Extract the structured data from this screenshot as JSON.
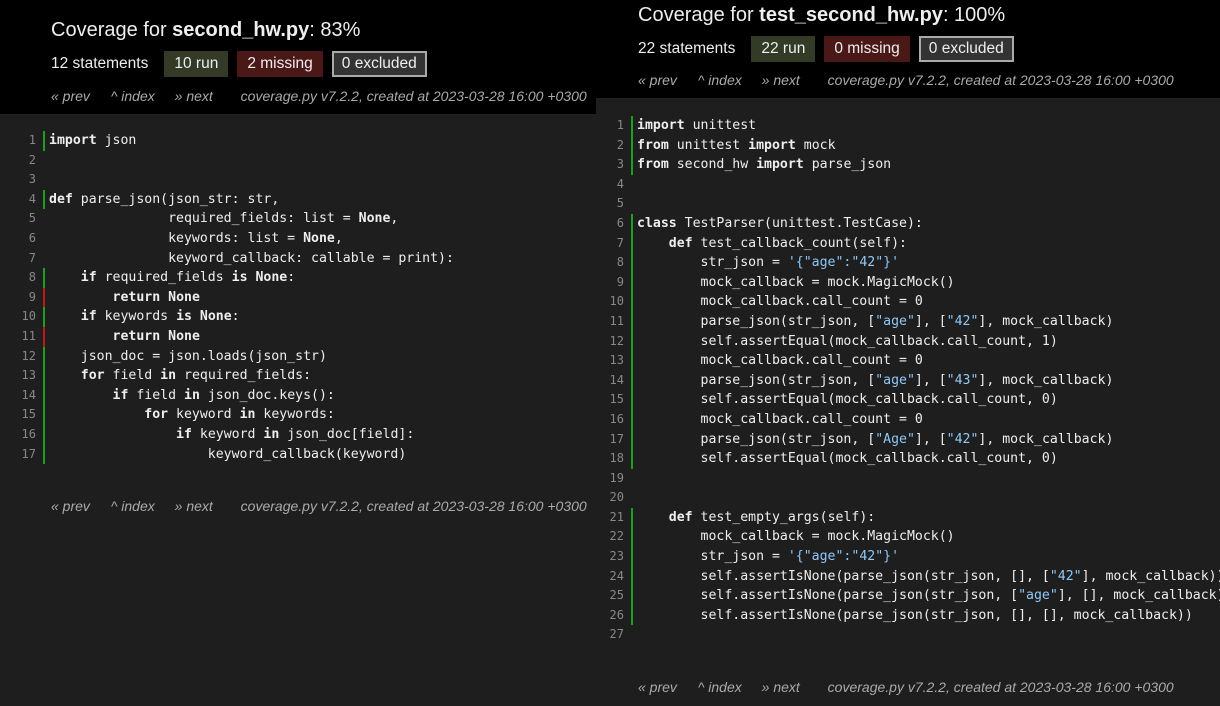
{
  "left": {
    "title_prefix": "Coverage for ",
    "file": "second_hw.py",
    "title_suffix": ": 83%",
    "statements": "12 statements",
    "run": "10 run",
    "missing": "2 missing",
    "excluded": "0 excluded",
    "nav": {
      "prev": "« prev",
      "index": "^ index",
      "next": "» next",
      "created": "coverage.py v7.2.2, created at 2023-03-28 16:00 +0300"
    },
    "lines": [
      {
        "n": "1",
        "s": "run",
        "t": [
          [
            "kw",
            "import"
          ],
          [
            "",
            " json"
          ]
        ]
      },
      {
        "n": "2",
        "s": "",
        "t": []
      },
      {
        "n": "3",
        "s": "",
        "t": []
      },
      {
        "n": "4",
        "s": "run",
        "t": [
          [
            "kw",
            "def"
          ],
          [
            "",
            " parse_json(json_str: str,"
          ]
        ]
      },
      {
        "n": "5",
        "s": "",
        "t": [
          [
            "",
            "               required_fields: list = "
          ],
          [
            "kw",
            "None"
          ],
          [
            "",
            ","
          ]
        ]
      },
      {
        "n": "6",
        "s": "",
        "t": [
          [
            "",
            "               keywords: list = "
          ],
          [
            "kw",
            "None"
          ],
          [
            "",
            ","
          ]
        ]
      },
      {
        "n": "7",
        "s": "",
        "t": [
          [
            "",
            "               keyword_callback: callable = print):"
          ]
        ]
      },
      {
        "n": "8",
        "s": "run",
        "t": [
          [
            "",
            "    "
          ],
          [
            "kw",
            "if"
          ],
          [
            "",
            " required_fields "
          ],
          [
            "kw",
            "is"
          ],
          [
            "",
            " "
          ],
          [
            "kw",
            "None"
          ],
          [
            "",
            ":"
          ]
        ]
      },
      {
        "n": "9",
        "s": "mis",
        "t": [
          [
            "",
            "        "
          ],
          [
            "kw",
            "return"
          ],
          [
            "",
            " "
          ],
          [
            "kw",
            "None"
          ]
        ]
      },
      {
        "n": "10",
        "s": "run",
        "t": [
          [
            "",
            "    "
          ],
          [
            "kw",
            "if"
          ],
          [
            "",
            " keywords "
          ],
          [
            "kw",
            "is"
          ],
          [
            "",
            " "
          ],
          [
            "kw",
            "None"
          ],
          [
            "",
            ":"
          ]
        ]
      },
      {
        "n": "11",
        "s": "mis",
        "t": [
          [
            "",
            "        "
          ],
          [
            "kw",
            "return"
          ],
          [
            "",
            " "
          ],
          [
            "kw",
            "None"
          ]
        ]
      },
      {
        "n": "12",
        "s": "run",
        "t": [
          [
            "",
            "    json_doc = json.loads(json_str)"
          ]
        ]
      },
      {
        "n": "13",
        "s": "run",
        "t": [
          [
            "",
            "    "
          ],
          [
            "kw",
            "for"
          ],
          [
            "",
            " field "
          ],
          [
            "kw",
            "in"
          ],
          [
            "",
            " required_fields:"
          ]
        ]
      },
      {
        "n": "14",
        "s": "run",
        "t": [
          [
            "",
            "        "
          ],
          [
            "kw",
            "if"
          ],
          [
            "",
            " field "
          ],
          [
            "kw",
            "in"
          ],
          [
            "",
            " json_doc.keys():"
          ]
        ]
      },
      {
        "n": "15",
        "s": "run",
        "t": [
          [
            "",
            "            "
          ],
          [
            "kw",
            "for"
          ],
          [
            "",
            " keyword "
          ],
          [
            "kw",
            "in"
          ],
          [
            "",
            " keywords:"
          ]
        ]
      },
      {
        "n": "16",
        "s": "run",
        "t": [
          [
            "",
            "                "
          ],
          [
            "kw",
            "if"
          ],
          [
            "",
            " keyword "
          ],
          [
            "kw",
            "in"
          ],
          [
            "",
            " json_doc[field]:"
          ]
        ]
      },
      {
        "n": "17",
        "s": "run",
        "t": [
          [
            "",
            "                    keyword_callback(keyword)"
          ]
        ]
      }
    ]
  },
  "right": {
    "title_prefix": "Coverage for ",
    "file": "test_second_hw.py",
    "title_suffix": ": 100%",
    "statements": "22 statements",
    "run": "22 run",
    "missing": "0 missing",
    "excluded": "0 excluded",
    "nav": {
      "prev": "« prev",
      "index": "^ index",
      "next": "» next",
      "created": "coverage.py v7.2.2, created at 2023-03-28 16:00 +0300"
    },
    "lines": [
      {
        "n": "1",
        "s": "run",
        "t": [
          [
            "kw",
            "import"
          ],
          [
            "",
            " unittest"
          ]
        ]
      },
      {
        "n": "2",
        "s": "run",
        "t": [
          [
            "kw",
            "from"
          ],
          [
            "",
            " unittest "
          ],
          [
            "kw",
            "import"
          ],
          [
            "",
            " mock"
          ]
        ]
      },
      {
        "n": "3",
        "s": "run",
        "t": [
          [
            "kw",
            "from"
          ],
          [
            "",
            " second_hw "
          ],
          [
            "kw",
            "import"
          ],
          [
            "",
            " parse_json"
          ]
        ]
      },
      {
        "n": "4",
        "s": "",
        "t": []
      },
      {
        "n": "5",
        "s": "",
        "t": []
      },
      {
        "n": "6",
        "s": "run",
        "t": [
          [
            "kw",
            "class"
          ],
          [
            "",
            " TestParser(unittest.TestCase):"
          ]
        ]
      },
      {
        "n": "7",
        "s": "run",
        "t": [
          [
            "",
            "    "
          ],
          [
            "kw",
            "def"
          ],
          [
            "",
            " test_callback_count(self):"
          ]
        ]
      },
      {
        "n": "8",
        "s": "run",
        "t": [
          [
            "",
            "        str_json = "
          ],
          [
            "str",
            "'{\"age\":\"42\"}'"
          ]
        ]
      },
      {
        "n": "9",
        "s": "run",
        "t": [
          [
            "",
            "        mock_callback = mock.MagicMock()"
          ]
        ]
      },
      {
        "n": "10",
        "s": "run",
        "t": [
          [
            "",
            "        mock_callback.call_count = 0"
          ]
        ]
      },
      {
        "n": "11",
        "s": "run",
        "t": [
          [
            "",
            "        parse_json(str_json, ["
          ],
          [
            "str",
            "\"age\""
          ],
          [
            "",
            "], ["
          ],
          [
            "str",
            "\"42\""
          ],
          [
            "",
            "], mock_callback)"
          ]
        ]
      },
      {
        "n": "12",
        "s": "run",
        "t": [
          [
            "",
            "        self.assertEqual(mock_callback.call_count, 1)"
          ]
        ]
      },
      {
        "n": "13",
        "s": "run",
        "t": [
          [
            "",
            "        mock_callback.call_count = 0"
          ]
        ]
      },
      {
        "n": "14",
        "s": "run",
        "t": [
          [
            "",
            "        parse_json(str_json, ["
          ],
          [
            "str",
            "\"age\""
          ],
          [
            "",
            "], ["
          ],
          [
            "str",
            "\"43\""
          ],
          [
            "",
            "], mock_callback)"
          ]
        ]
      },
      {
        "n": "15",
        "s": "run",
        "t": [
          [
            "",
            "        self.assertEqual(mock_callback.call_count, 0)"
          ]
        ]
      },
      {
        "n": "16",
        "s": "run",
        "t": [
          [
            "",
            "        mock_callback.call_count = 0"
          ]
        ]
      },
      {
        "n": "17",
        "s": "run",
        "t": [
          [
            "",
            "        parse_json(str_json, ["
          ],
          [
            "str",
            "\"Age\""
          ],
          [
            "",
            "], ["
          ],
          [
            "str",
            "\"42\""
          ],
          [
            "",
            "], mock_callback)"
          ]
        ]
      },
      {
        "n": "18",
        "s": "run",
        "t": [
          [
            "",
            "        self.assertEqual(mock_callback.call_count, 0)"
          ]
        ]
      },
      {
        "n": "19",
        "s": "",
        "t": []
      },
      {
        "n": "20",
        "s": "",
        "t": []
      },
      {
        "n": "21",
        "s": "run",
        "t": [
          [
            "",
            "    "
          ],
          [
            "kw",
            "def"
          ],
          [
            "",
            " test_empty_args(self):"
          ]
        ]
      },
      {
        "n": "22",
        "s": "run",
        "t": [
          [
            "",
            "        mock_callback = mock.MagicMock()"
          ]
        ]
      },
      {
        "n": "23",
        "s": "run",
        "t": [
          [
            "",
            "        str_json = "
          ],
          [
            "str",
            "'{\"age\":\"42\"}'"
          ]
        ]
      },
      {
        "n": "24",
        "s": "run",
        "t": [
          [
            "",
            "        self.assertIsNone(parse_json(str_json, [], ["
          ],
          [
            "str",
            "\"42\""
          ],
          [
            "",
            "], mock_callback))"
          ]
        ]
      },
      {
        "n": "25",
        "s": "run",
        "t": [
          [
            "",
            "        self.assertIsNone(parse_json(str_json, ["
          ],
          [
            "str",
            "\"age\""
          ],
          [
            "",
            "], [], mock_callback))"
          ]
        ]
      },
      {
        "n": "26",
        "s": "run",
        "t": [
          [
            "",
            "        self.assertIsNone(parse_json(str_json, [], [], mock_callback))"
          ]
        ]
      },
      {
        "n": "27",
        "s": "",
        "t": []
      }
    ]
  }
}
